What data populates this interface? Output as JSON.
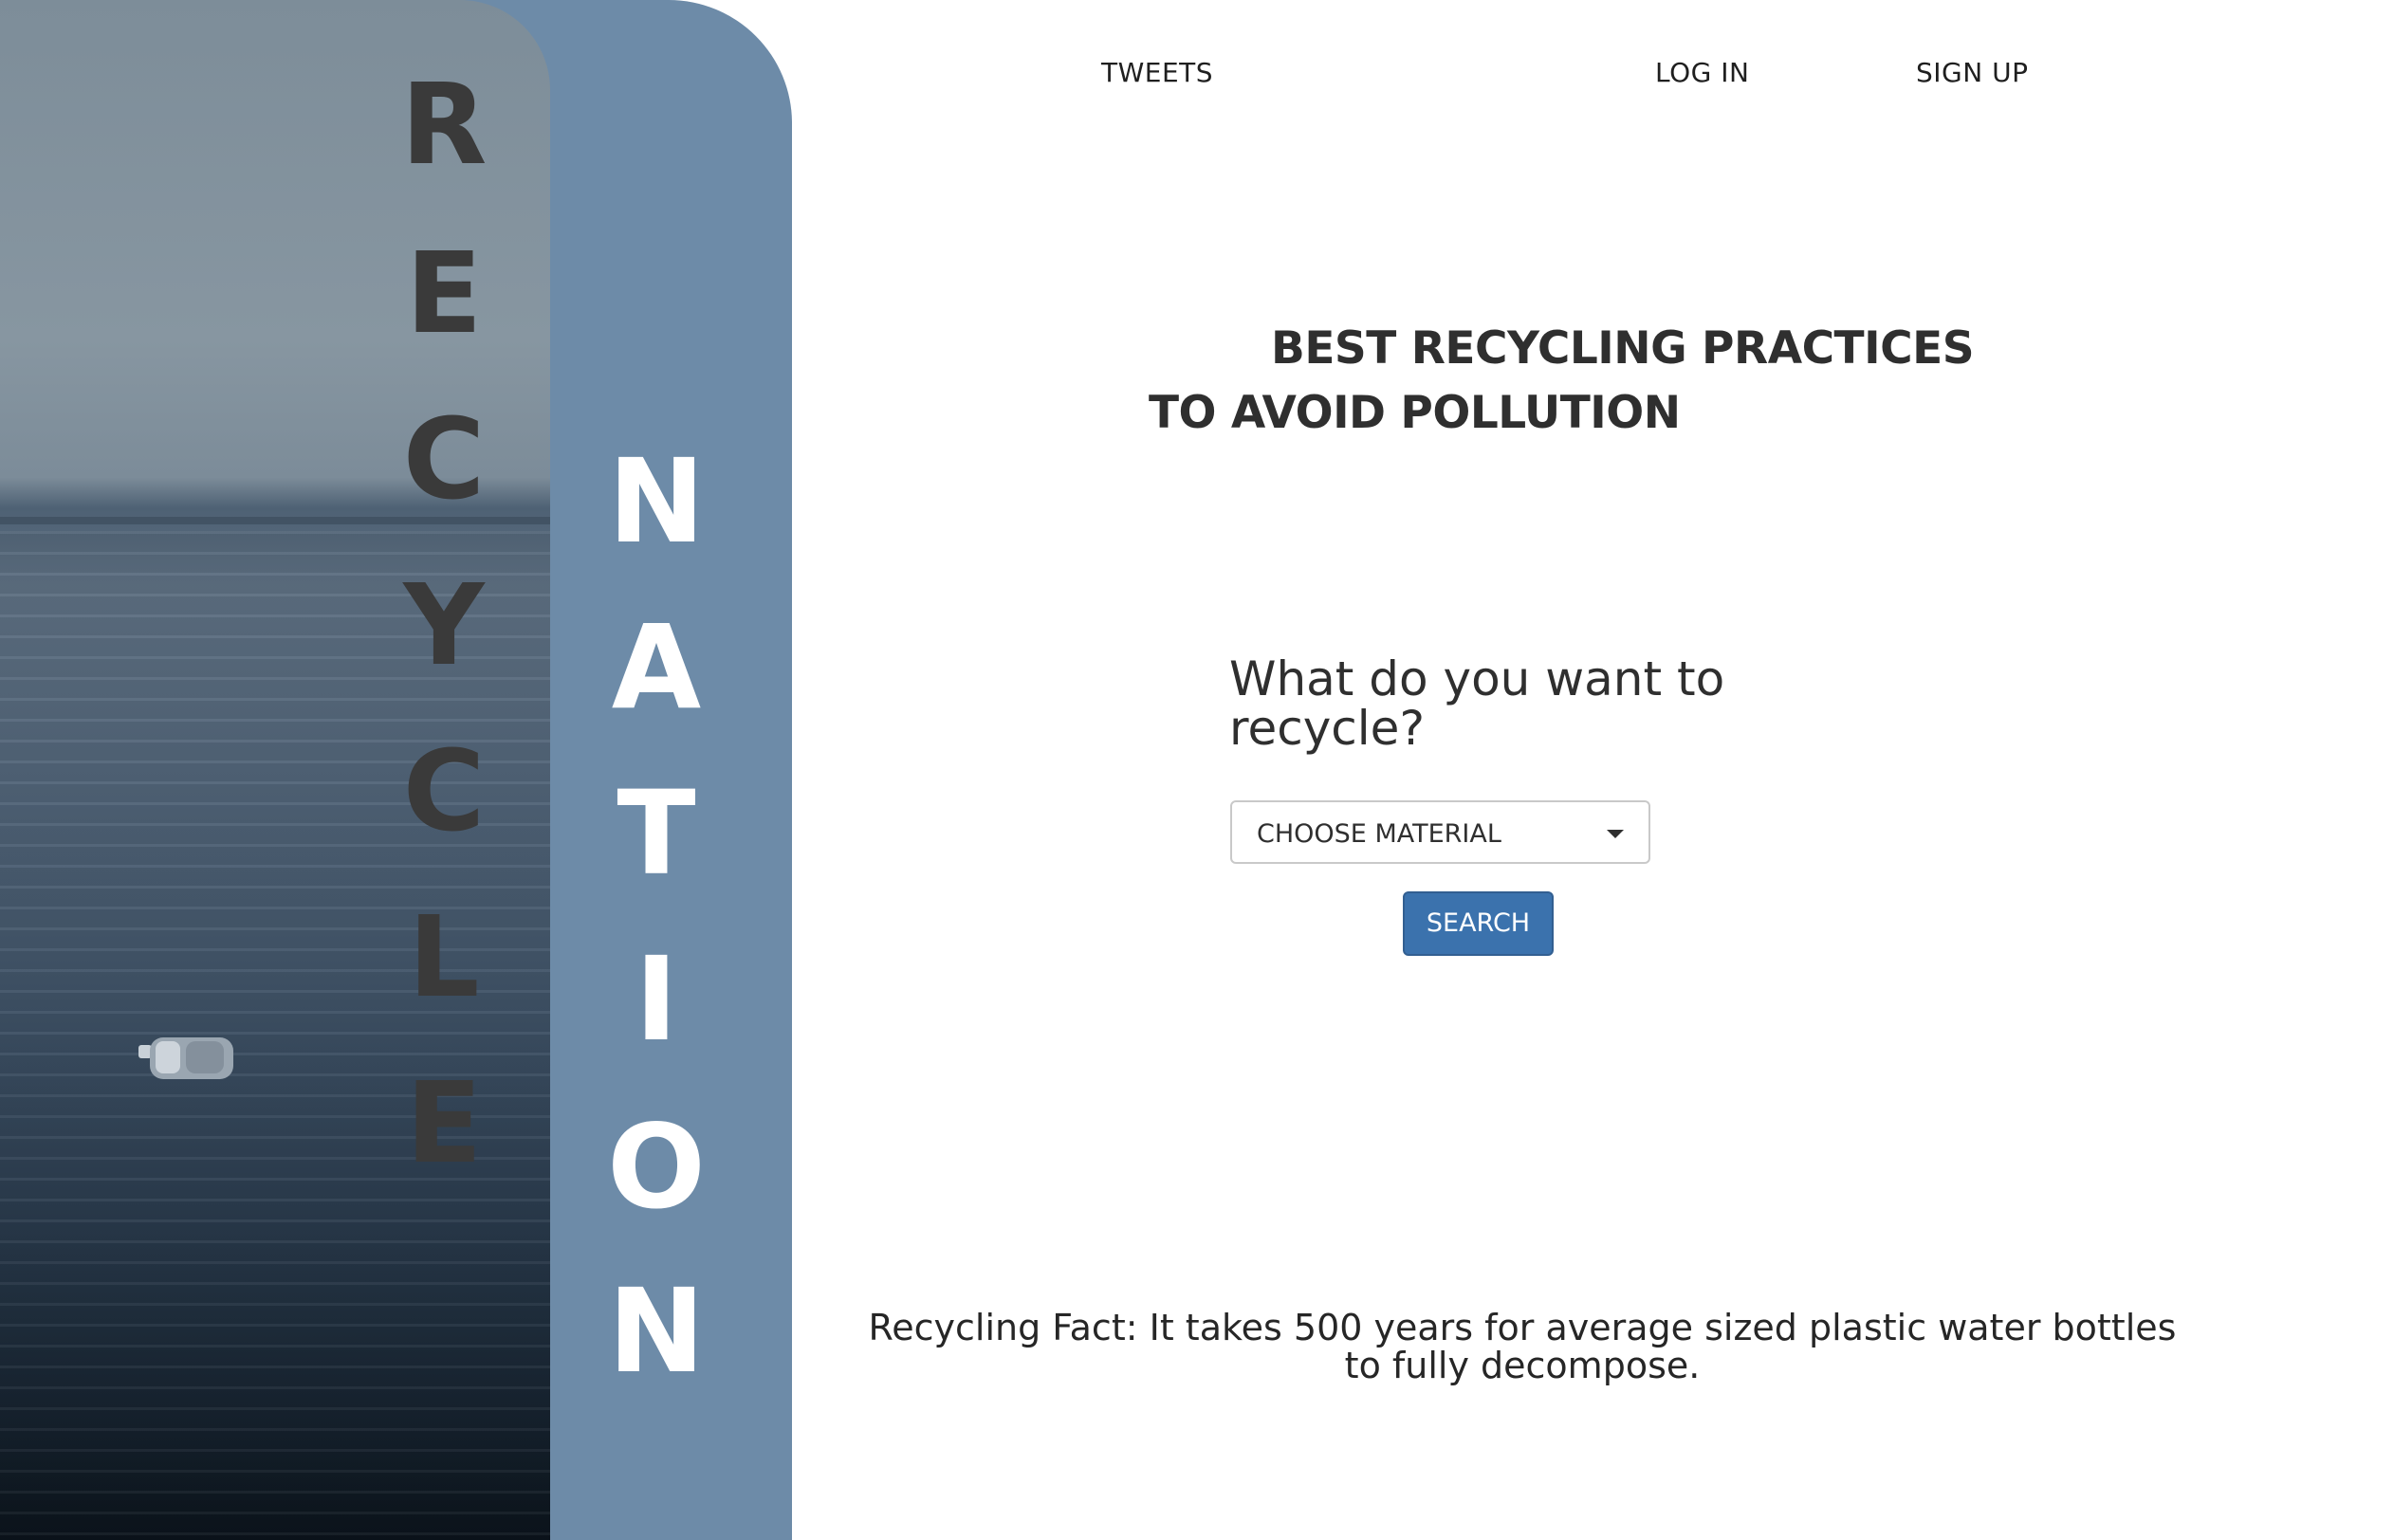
{
  "nav": {
    "tweets": "TWEETS",
    "login": "LOG IN",
    "signup": "SIGN UP"
  },
  "hero": {
    "word1": [
      "R",
      "E",
      "C",
      "Y",
      "C",
      "L",
      "E"
    ],
    "word2": [
      "N",
      "A",
      "T",
      "I",
      "O",
      "N"
    ]
  },
  "headline": {
    "line1": "BEST RECYCLING PRACTICES",
    "line2": "TO AVOID POLLUTION"
  },
  "search": {
    "question": "What do you want to recycle?",
    "select_value": "CHOOSE MATERIAL",
    "button_label": "SEARCH"
  },
  "fact": {
    "text": "Recycling Fact: It takes 500 years for average sized plastic water bottles to fully decompose."
  },
  "colors": {
    "panel_blue": "#6d8ba8",
    "button_blue": "#3b72ad",
    "text_dark": "#2f2f2f"
  }
}
